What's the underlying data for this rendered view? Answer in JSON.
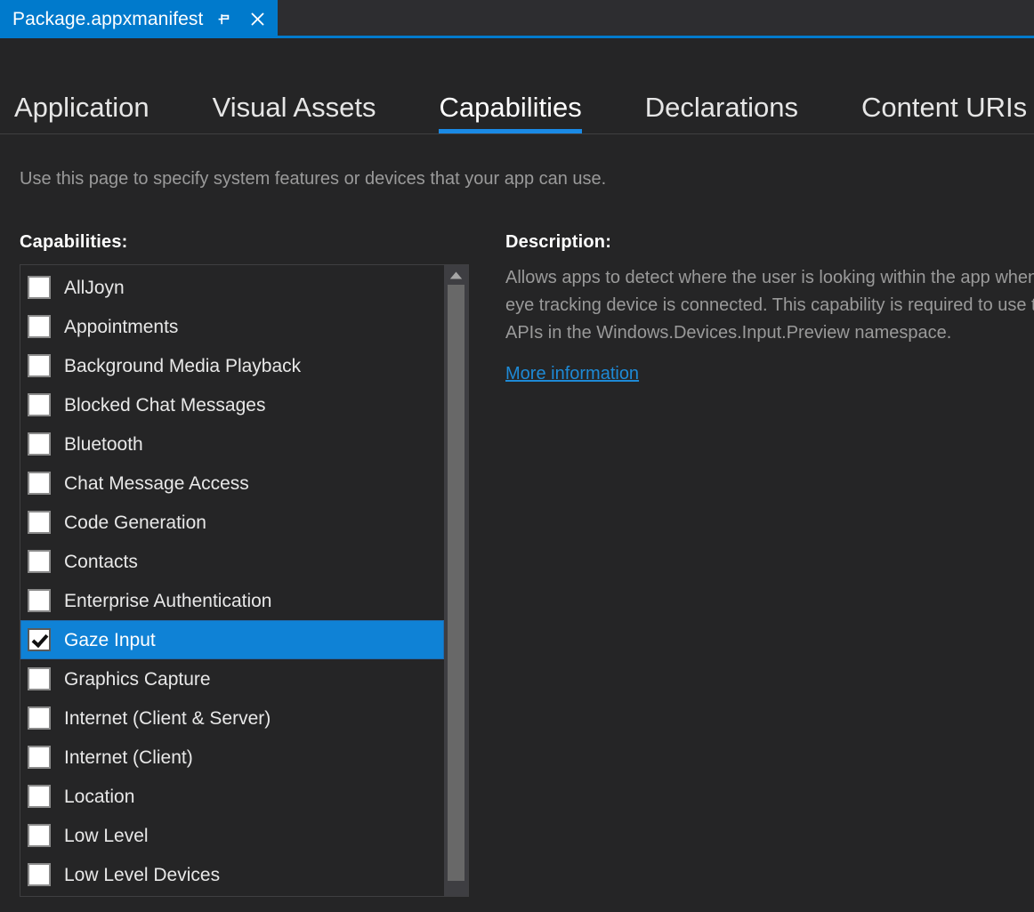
{
  "window": {
    "document_tab": {
      "title": "Package.appxmanifest",
      "pin_icon": "pin-icon",
      "close_icon": "close-icon"
    }
  },
  "designer": {
    "tabs": [
      {
        "label": "Application",
        "active": false
      },
      {
        "label": "Visual Assets",
        "active": false
      },
      {
        "label": "Capabilities",
        "active": true
      },
      {
        "label": "Declarations",
        "active": false
      },
      {
        "label": "Content URIs",
        "active": false
      }
    ]
  },
  "page": {
    "hint": "Use this page to specify system features or devices that your app can use.",
    "capabilities_label": "Capabilities:",
    "description_label": "Description:"
  },
  "capabilities": {
    "items": [
      {
        "label": "AllJoyn",
        "checked": false,
        "selected": false
      },
      {
        "label": "Appointments",
        "checked": false,
        "selected": false
      },
      {
        "label": "Background Media Playback",
        "checked": false,
        "selected": false
      },
      {
        "label": "Blocked Chat Messages",
        "checked": false,
        "selected": false
      },
      {
        "label": "Bluetooth",
        "checked": false,
        "selected": false
      },
      {
        "label": "Chat Message Access",
        "checked": false,
        "selected": false
      },
      {
        "label": "Code Generation",
        "checked": false,
        "selected": false
      },
      {
        "label": "Contacts",
        "checked": false,
        "selected": false
      },
      {
        "label": "Enterprise Authentication",
        "checked": false,
        "selected": false
      },
      {
        "label": "Gaze Input",
        "checked": true,
        "selected": true
      },
      {
        "label": "Graphics Capture",
        "checked": false,
        "selected": false
      },
      {
        "label": "Internet (Client & Server)",
        "checked": false,
        "selected": false
      },
      {
        "label": "Internet (Client)",
        "checked": false,
        "selected": false
      },
      {
        "label": "Location",
        "checked": false,
        "selected": false
      },
      {
        "label": "Low Level",
        "checked": false,
        "selected": false
      },
      {
        "label": "Low Level Devices",
        "checked": false,
        "selected": false
      }
    ],
    "scrollbar": {
      "up_arrow_icon": "scroll-up-arrow-icon"
    }
  },
  "description": {
    "text": "Allows apps to detect where the user is looking within the app when an eye tracking device is connected. This capability is required to use the APIs in the Windows.Devices.Input.Preview namespace.",
    "more_information_label": "More information"
  },
  "colors": {
    "accent_blue": "#007acc",
    "selection_blue": "#0f82d6",
    "tab_underline_blue": "#1a8ae5",
    "link_blue": "#1e8ad6",
    "window_background": "#252526",
    "titlebar_background": "#2d2d30",
    "muted_text": "#9a9a9a",
    "scrollbar_track": "#3e3e42",
    "scrollbar_thumb": "#686868"
  }
}
